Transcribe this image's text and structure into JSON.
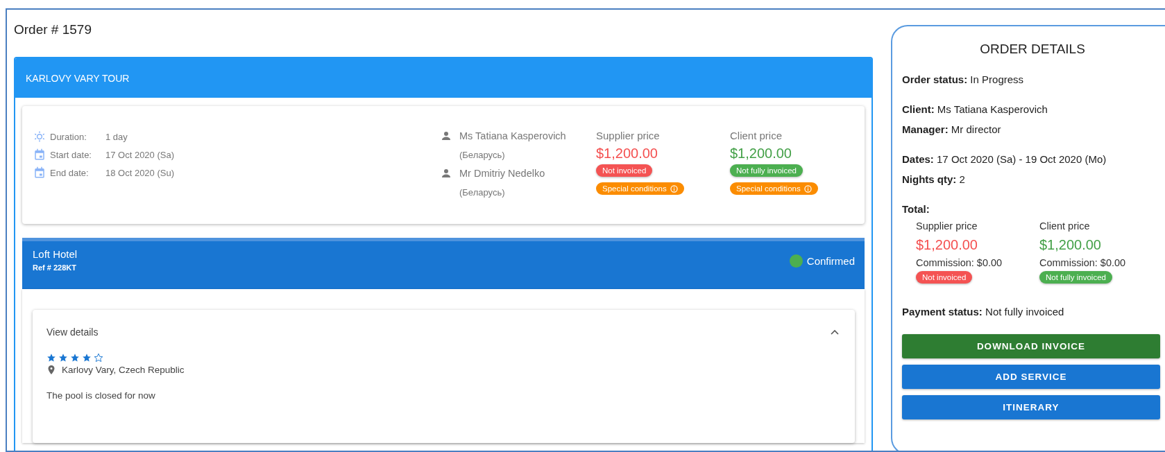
{
  "title": "Order # 1579",
  "tour": {
    "title": "KARLOVY VARY TOUR",
    "info": [
      {
        "kind": "duration",
        "label": "Duration:",
        "value": "1 day"
      },
      {
        "kind": "date",
        "label": "Start date:",
        "value": "17 Oct 2020 (Sa)"
      },
      {
        "kind": "date",
        "label": "End date:",
        "value": "18 Oct 2020 (Su)"
      }
    ],
    "travelers": [
      {
        "name": "Ms Tatiana Kasperovich",
        "country": "(Беларусь)"
      },
      {
        "name": "Mr Dmitriy Nedelko",
        "country": "(Беларусь)"
      }
    ],
    "prices": [
      {
        "label": "Supplier price",
        "amount": "$1,200.00",
        "color": "#f44f4f",
        "badges": [
          {
            "text": "Not invoiced",
            "color": "#f45353",
            "info": false
          },
          {
            "text": "Special conditions",
            "color": "#fb8c00",
            "info": true
          }
        ]
      },
      {
        "label": "Client price",
        "amount": "$1,200.00",
        "color": "#43a047",
        "badges": [
          {
            "text": "Not fully invoiced",
            "color": "#4caf50",
            "info": false
          },
          {
            "text": "Special conditions",
            "color": "#fb8c00",
            "info": true
          }
        ]
      }
    ]
  },
  "hotel": {
    "name": "Loft Hotel",
    "ref": "Ref # 228KT",
    "status": {
      "text": "Confirmed",
      "color": "#4caf50"
    },
    "details": {
      "summary": "View details",
      "expanded": true,
      "stars": 4,
      "location": "Karlovy Vary, Czech Republic",
      "note": "The pool is closed for now"
    }
  },
  "order_details": {
    "heading": "ORDER DETAILS",
    "groups": [
      [
        "**Order status:** In Progress"
      ],
      [
        "**Client:** Ms Tatiana Kasperovich",
        "**Manager:** Mr director"
      ],
      [
        "**Dates:** 17 Oct 2020 (Sa) - 19 Oct 2020 (Mo)",
        "**Nights qty:** 2"
      ]
    ],
    "total_label": "Total:",
    "totals": [
      {
        "label": "Supplier price",
        "amount": "$1,200.00",
        "color": "#f44f4f",
        "commission": "Commission: $0.00",
        "badge": {
          "text": "Not invoiced",
          "color": "#f45353"
        }
      },
      {
        "label": "Client price",
        "amount": "$1,200.00",
        "color": "#43a047",
        "commission": "Commission: $0.00",
        "badge": {
          "text": "Not fully invoiced",
          "color": "#4caf50"
        }
      }
    ],
    "payment_status": "**Payment status:** Not fully invoiced",
    "buttons": [
      {
        "label": "DOWNLOAD INVOICE",
        "kind": "success"
      },
      {
        "label": "ADD SERVICE",
        "kind": "primary"
      },
      {
        "label": "ITINERARY",
        "kind": "primary"
      }
    ]
  }
}
